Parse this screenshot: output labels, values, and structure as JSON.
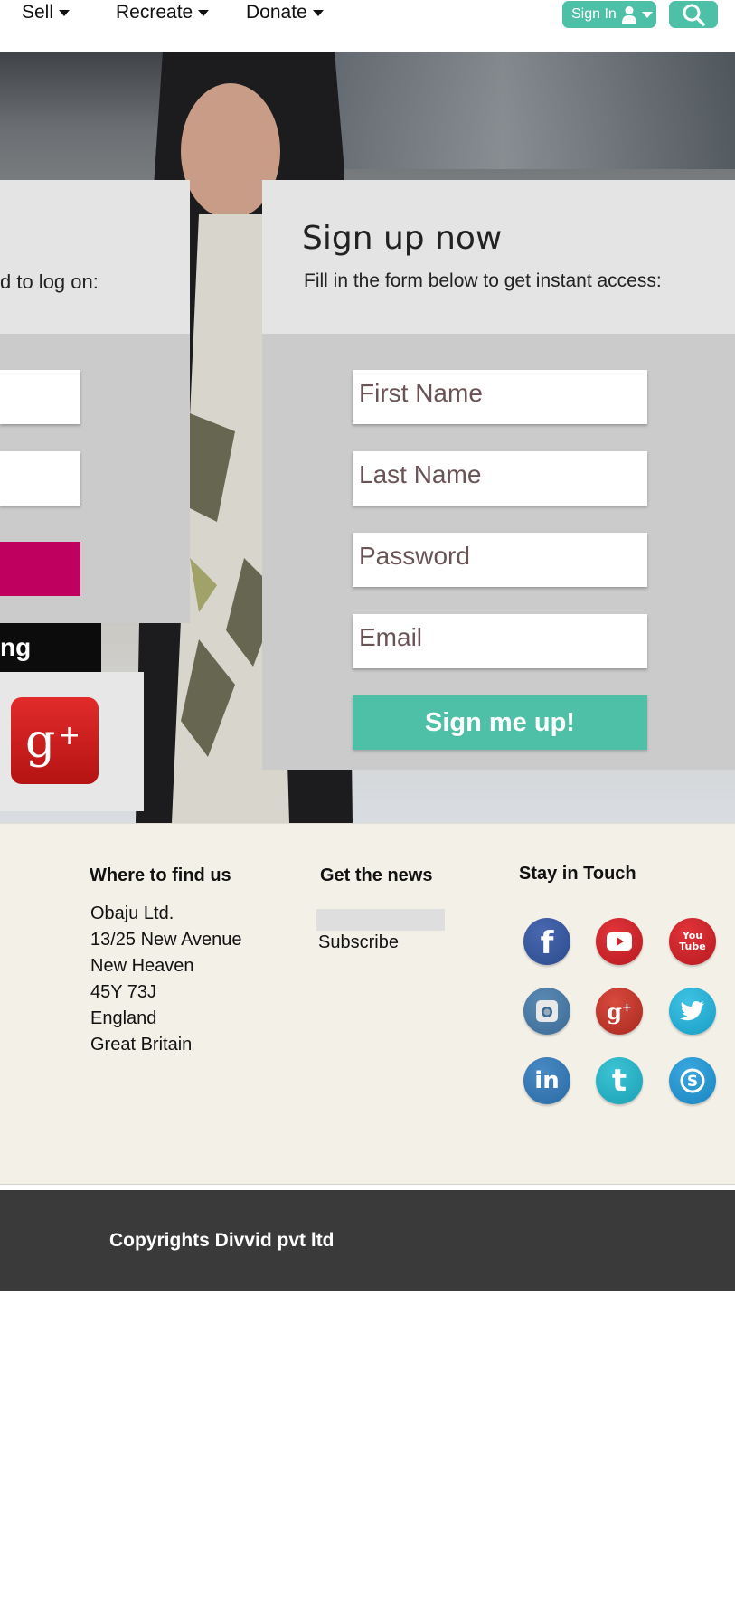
{
  "nav": {
    "items": [
      {
        "label": "Sell"
      },
      {
        "label": "Recreate"
      },
      {
        "label": "Donate"
      }
    ],
    "signin_label": "Sign In"
  },
  "login": {
    "subtitle": "d to log on:",
    "social_strip_text": "ng"
  },
  "signup": {
    "title": "Sign up now",
    "subtitle": "Fill in the form below to get instant access:",
    "first_name_placeholder": "First Name",
    "last_name_placeholder": "Last Name",
    "password_placeholder": "Password",
    "email_placeholder": "Email",
    "submit_label": "Sign me up!"
  },
  "footer": {
    "find_us_title": "Where to find us",
    "address_lines": [
      "Obaju Ltd.",
      "13/25 New Avenue",
      "New Heaven",
      "45Y 73J",
      "England",
      "Great Britain"
    ],
    "news_title": "Get the news",
    "subscribe_label": "Subscribe",
    "touch_title": "Stay in Touch",
    "social_icons": [
      "facebook-icon",
      "youtube-icon",
      "youtube-classic-icon",
      "instagram-icon",
      "google-plus-icon",
      "twitter-icon",
      "linkedin-icon",
      "tumblr-icon",
      "skype-icon"
    ],
    "copyright": "Copyrights Divvid pvt ltd"
  },
  "colors": {
    "accent": "#4fc0a8",
    "login_button": "#c0005f",
    "footer_bg": "#f3f0e8",
    "copyright_bg": "#3a3a3a"
  }
}
